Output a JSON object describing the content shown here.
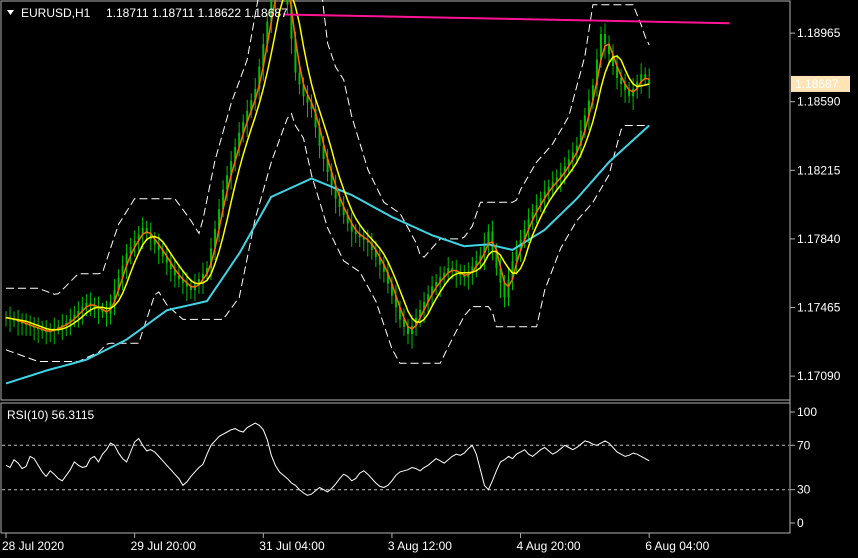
{
  "header": {
    "symbol_label": "EURUSD,H1",
    "ohlc": "1.18711 1.18711 1.18622 1.18687"
  },
  "colors": {
    "background": "#000000",
    "candles": "#00c000",
    "ma_fast": "#ff6a00",
    "ma_mid": "#ffff00",
    "ma_slow": "#3fd4e6",
    "bands": "#ffffff",
    "resistance": "#ff1493",
    "price_tag_bg": "#ffe4b5"
  },
  "chart_data": [
    {
      "type": "line",
      "title": "EURUSD,H1",
      "subtitle": "1.18711 1.18711 1.18622 1.18687",
      "ylim": [
        1.16965,
        1.19135
      ],
      "y_ticks": [
        "1.18965",
        "1.18590",
        "1.18215",
        "1.17840",
        "1.17465",
        "1.17090"
      ],
      "y_tick_values": [
        1.18965,
        1.1859,
        1.18215,
        1.1784,
        1.17465,
        1.1709
      ],
      "x_ticks": [
        "28 Jul 2020",
        "29 Jul 20:00",
        "31 Jul 04:00",
        "3 Aug 12:00",
        "4 Aug 20:00",
        "6 Aug 04:00"
      ],
      "x_tick_bars": [
        0,
        32,
        64,
        96,
        128,
        160
      ],
      "current_price": "1.18687",
      "current_price_value": 1.18687,
      "resistance_line": {
        "start_bar": 69,
        "end_bar": 180,
        "start_value": 1.19067,
        "end_value": 1.19019
      },
      "close_anchors": [
        [
          0,
          1.1741
        ],
        [
          5,
          1.1737
        ],
        [
          10,
          1.1733
        ],
        [
          15,
          1.1738
        ],
        [
          20,
          1.1749
        ],
        [
          25,
          1.1743
        ],
        [
          30,
          1.1776
        ],
        [
          34,
          1.179
        ],
        [
          38,
          1.1778
        ],
        [
          42,
          1.1764
        ],
        [
          46,
          1.1756
        ],
        [
          50,
          1.1768
        ],
        [
          54,
          1.1811
        ],
        [
          58,
          1.1842
        ],
        [
          62,
          1.1866
        ],
        [
          66,
          1.1915
        ],
        [
          68,
          1.1936
        ],
        [
          70,
          1.1912
        ],
        [
          72,
          1.1875
        ],
        [
          74,
          1.1862
        ],
        [
          76,
          1.1855
        ],
        [
          78,
          1.1835
        ],
        [
          82,
          1.1806
        ],
        [
          86,
          1.1788
        ],
        [
          90,
          1.1782
        ],
        [
          94,
          1.1766
        ],
        [
          98,
          1.174
        ],
        [
          100,
          1.1732
        ],
        [
          102,
          1.1741
        ],
        [
          106,
          1.1758
        ],
        [
          110,
          1.1768
        ],
        [
          114,
          1.1763
        ],
        [
          118,
          1.1775
        ],
        [
          120,
          1.1788
        ],
        [
          122,
          1.1768
        ],
        [
          124,
          1.1752
        ],
        [
          126,
          1.1772
        ],
        [
          130,
          1.1795
        ],
        [
          134,
          1.181
        ],
        [
          138,
          1.182
        ],
        [
          142,
          1.1835
        ],
        [
          146,
          1.1868
        ],
        [
          148,
          1.1896
        ],
        [
          150,
          1.1885
        ],
        [
          152,
          1.1872
        ],
        [
          155,
          1.1862
        ],
        [
          158,
          1.1874
        ],
        [
          160,
          1.18687
        ]
      ],
      "slow_ma_anchors": [
        [
          0,
          1.1705
        ],
        [
          10,
          1.1712
        ],
        [
          20,
          1.1718
        ],
        [
          30,
          1.1729
        ],
        [
          40,
          1.1745
        ],
        [
          50,
          1.175
        ],
        [
          58,
          1.1776
        ],
        [
          66,
          1.1807
        ],
        [
          76,
          1.1817
        ],
        [
          86,
          1.1808
        ],
        [
          96,
          1.1796
        ],
        [
          106,
          1.1786
        ],
        [
          114,
          1.178
        ],
        [
          120,
          1.1781
        ],
        [
          126,
          1.1778
        ],
        [
          134,
          1.1789
        ],
        [
          142,
          1.1806
        ],
        [
          150,
          1.1826
        ],
        [
          160,
          1.1846
        ]
      ],
      "series": []
    },
    {
      "type": "line",
      "title": "RSI(10) 56.3115",
      "ylim": [
        0,
        100
      ],
      "y_ticks": [
        "100",
        "70",
        "30",
        "0"
      ],
      "y_tick_values": [
        100,
        70,
        30,
        0
      ],
      "levels": [
        70,
        30
      ],
      "series": [
        {
          "name": "RSI(10)",
          "values": [
            52,
            50,
            57,
            54,
            49,
            51,
            60,
            58,
            52,
            46,
            42,
            47,
            44,
            40,
            38,
            43,
            48,
            55,
            52,
            50,
            51,
            58,
            60,
            55,
            62,
            66,
            72,
            70,
            63,
            58,
            55,
            64,
            73,
            76,
            70,
            65,
            66,
            64,
            60,
            56,
            52,
            48,
            44,
            40,
            34,
            37,
            42,
            46,
            50,
            53,
            62,
            70,
            74,
            78,
            80,
            82,
            84,
            85,
            83,
            82,
            86,
            88,
            90,
            88,
            84,
            75,
            61,
            52,
            46,
            43,
            40,
            36,
            34,
            30,
            27,
            25,
            26,
            29,
            32,
            30,
            28,
            31,
            35,
            40,
            44,
            42,
            38,
            40,
            45,
            47,
            44,
            40,
            36,
            33,
            32,
            34,
            38,
            43,
            46,
            47,
            48,
            50,
            49,
            47,
            50,
            52,
            55,
            58,
            56,
            54,
            57,
            60,
            62,
            61,
            63,
            67,
            70,
            62,
            48,
            34,
            30,
            38,
            47,
            55,
            57,
            60,
            58,
            62,
            64,
            66,
            62,
            60,
            63,
            66,
            68,
            65,
            62,
            64,
            67,
            70,
            68,
            66,
            68,
            71,
            74,
            73,
            71,
            70,
            72,
            74,
            72,
            68,
            64,
            62,
            60,
            61,
            63,
            62,
            60,
            58,
            56
          ]
        }
      ]
    }
  ]
}
